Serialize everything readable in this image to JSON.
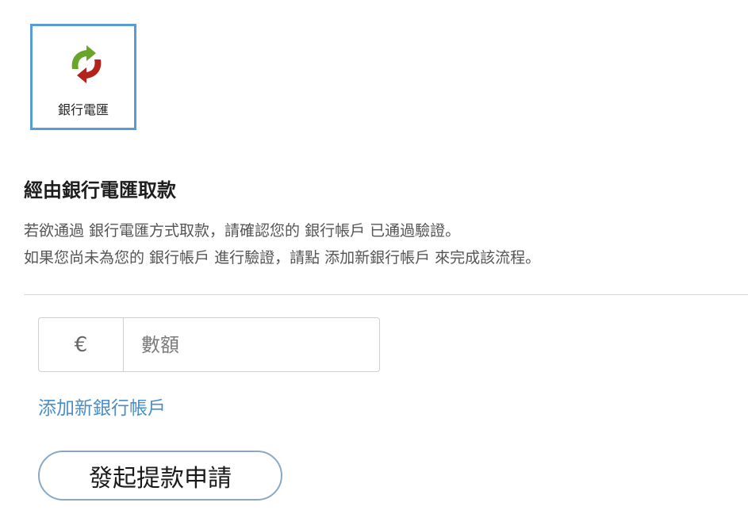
{
  "payment_method": {
    "label": "銀行電匯",
    "icon": "bank-transfer-arrows-icon",
    "colors": {
      "selected_border": "#5a9bd5",
      "arrow_green": "#6aa52b",
      "arrow_red": "#b3231c"
    }
  },
  "section": {
    "title": "經由銀行電匯取款",
    "description_line1": "若欲通過 銀行電匯方式取款，請確認您的 銀行帳戶 已通過驗證。",
    "description_line2": "如果您尚未為您的 銀行帳戶 進行驗證，請點 添加新銀行帳戶 來完成該流程。"
  },
  "amount": {
    "currency_symbol": "€",
    "placeholder": "數額",
    "value": ""
  },
  "add_account_link": "添加新銀行帳戶",
  "submit_button": "發起提款申請",
  "colors": {
    "link": "#4a8ec8",
    "button_border": "#8aa8c4"
  }
}
